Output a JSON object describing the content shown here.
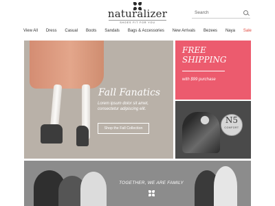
{
  "brand": {
    "name": "naturalizer",
    "tagline": "SHOES FIT FOR YOU"
  },
  "search": {
    "placeholder": "Search"
  },
  "nav": {
    "items": [
      "View All",
      "Dress",
      "Casual",
      "Boots",
      "Sandals",
      "Bags & Accessories",
      "New Arrivals",
      "Bezees",
      "Naya",
      "Sale"
    ]
  },
  "hero": {
    "title": "Fall Fanatics",
    "body": "Lorem ipsum dolor sit amet, consectetur adipiscing elit.",
    "button_label": "Shop the Fall Collection"
  },
  "promo": {
    "title": "FREE SHIPPING",
    "subtitle": "with $99 purchase"
  },
  "n5": {
    "badge_main": "N5",
    "badge_sub": "COMFORT"
  },
  "family": {
    "title": "TOGETHER, WE ARE FAMILY"
  },
  "colors": {
    "promo_bg": "#ec5b6e",
    "sale_text": "#e0493f"
  }
}
